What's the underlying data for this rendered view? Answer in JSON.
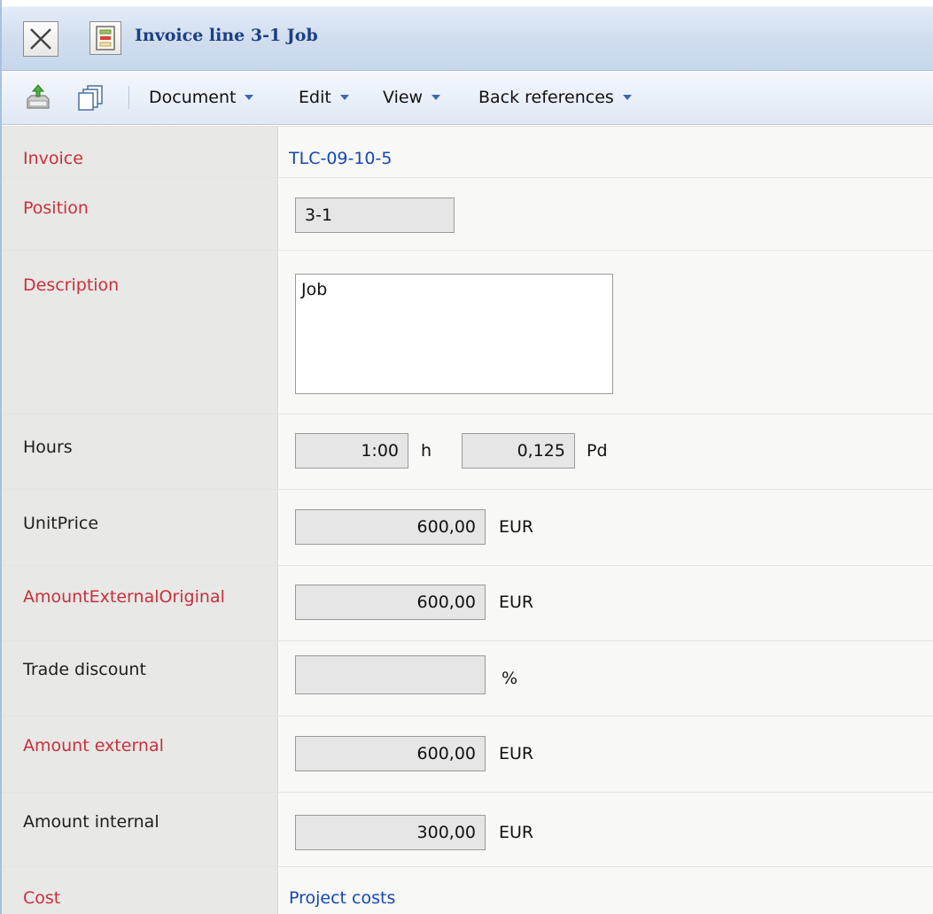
{
  "window": {
    "title": "Invoice line 3-1 Job"
  },
  "toolbar": {
    "menus": [
      "Document",
      "Edit",
      "View",
      "Back references"
    ]
  },
  "form": {
    "invoice": {
      "label": "Invoice",
      "value": "TLC-09-10-5"
    },
    "position": {
      "label": "Position",
      "value": "3-1"
    },
    "description": {
      "label": "Description",
      "value": "Job"
    },
    "hours": {
      "label": "Hours",
      "hours_value": "1:00",
      "hours_unit": "h",
      "days_value": "0,125",
      "days_unit": "Pd"
    },
    "unit_price": {
      "label": "UnitPrice",
      "value": "600,00",
      "unit": "EUR"
    },
    "amount_external_original": {
      "label": "AmountExternalOriginal",
      "value": "600,00",
      "unit": "EUR"
    },
    "trade_discount": {
      "label": "Trade discount",
      "value": "",
      "unit": "%"
    },
    "amount_external": {
      "label": "Amount external",
      "value": "600,00",
      "unit": "EUR"
    },
    "amount_internal": {
      "label": "Amount internal",
      "value": "300,00",
      "unit": "EUR"
    },
    "cost": {
      "label": "Cost",
      "value": "Project costs"
    }
  },
  "colors": {
    "required_label": "#c9303a",
    "link": "#1447b3",
    "title": "#1b3f84"
  },
  "icons": [
    "close-icon",
    "document-icon",
    "save-icon",
    "copy-icon",
    "dropdown-arrow-icon"
  ]
}
